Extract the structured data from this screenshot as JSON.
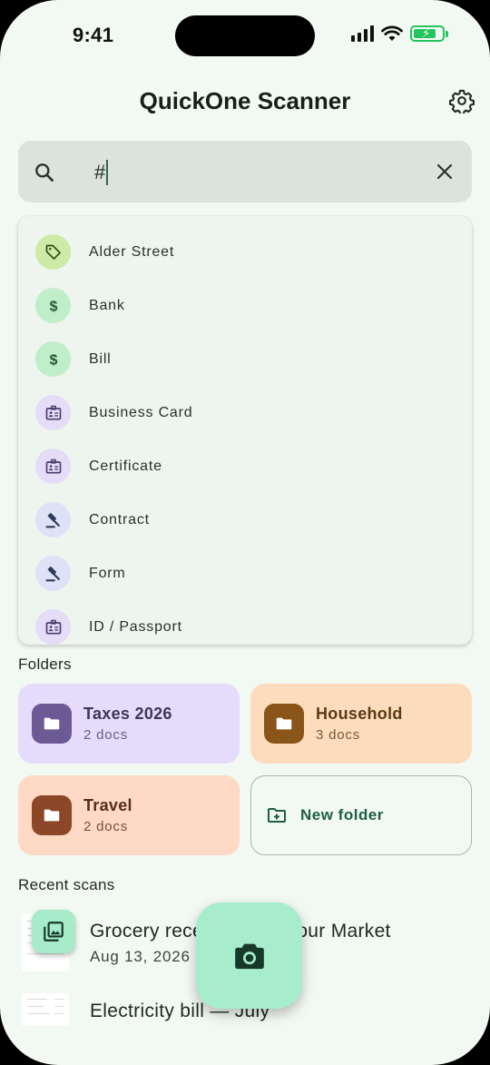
{
  "status_bar": {
    "time": "9:41"
  },
  "header": {
    "title": "QuickOne Scanner"
  },
  "search": {
    "query": "#"
  },
  "suggestions": [
    {
      "label": "Alder Street",
      "icon": "tag-icon",
      "badge_color": "#cdeba6",
      "icon_color": "#2f4a1a"
    },
    {
      "label": "Bank",
      "icon": "dollar-icon",
      "badge_color": "#bfeec8",
      "icon_color": "#1f5a30"
    },
    {
      "label": "Bill",
      "icon": "dollar-icon",
      "badge_color": "#bfeec8",
      "icon_color": "#1f5a30"
    },
    {
      "label": "Business Card",
      "icon": "id-card-icon",
      "badge_color": "#e5dcf7",
      "icon_color": "#4a3d6e"
    },
    {
      "label": "Certificate",
      "icon": "id-card-icon",
      "badge_color": "#e5dcf7",
      "icon_color": "#4a3d6e"
    },
    {
      "label": "Contract",
      "icon": "gavel-icon",
      "badge_color": "#dde2f6",
      "icon_color": "#2f3a5e"
    },
    {
      "label": "Form",
      "icon": "gavel-icon",
      "badge_color": "#dde2f6",
      "icon_color": "#2f3a5e"
    },
    {
      "label": "ID / Passport",
      "icon": "id-card-icon",
      "badge_color": "#e5dcf7",
      "icon_color": "#4a3d6e"
    }
  ],
  "folders_section": {
    "label": "Folders"
  },
  "folders": [
    {
      "name": "Taxes 2026",
      "count": "2 docs",
      "bg": "#e5dcfc",
      "icon_bg": "#6b5a93",
      "text": "#3f3556"
    },
    {
      "name": "Household",
      "count": "3 docs",
      "bg": "#fddcbd",
      "icon_bg": "#8a5518",
      "text": "#5a3a10"
    },
    {
      "name": "Travel",
      "count": "2 docs",
      "bg": "#fdd9c6",
      "icon_bg": "#8c4628",
      "text": "#5a2c18"
    }
  ],
  "new_folder": {
    "label": "New folder"
  },
  "recent_section": {
    "label": "Recent scans"
  },
  "recent_scans": [
    {
      "title": "Grocery receipt — Harbour Market",
      "subtitle": "Aug 13, 2026 · 184 KB"
    },
    {
      "title": "Electricity bill — July",
      "subtitle": ""
    }
  ],
  "fabs": {
    "gallery_icon": "gallery-icon",
    "camera_icon": "camera-icon"
  }
}
